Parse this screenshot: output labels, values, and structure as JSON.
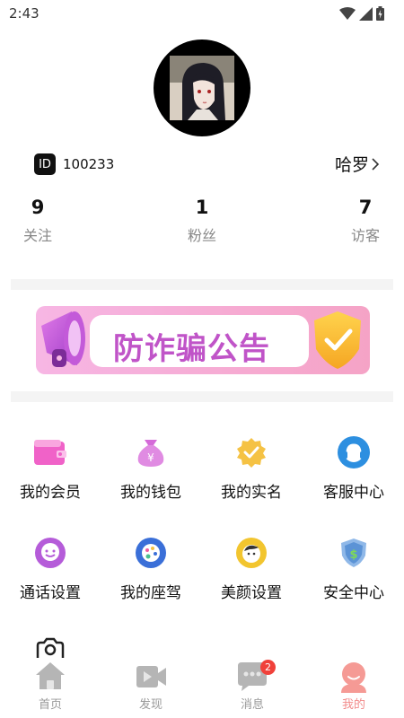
{
  "status_bar": {
    "time": "2:43",
    "icons": [
      "wifi-icon",
      "signal-icon",
      "battery-icon"
    ]
  },
  "profile": {
    "id_badge": "ID",
    "id_value": "100233",
    "name": "哈罗",
    "stats": [
      {
        "num": "9",
        "label": "关注"
      },
      {
        "num": "1",
        "label": "粉丝"
      },
      {
        "num": "7",
        "label": "访客"
      }
    ]
  },
  "banner": {
    "text": "防诈骗公告"
  },
  "menu": {
    "items": [
      {
        "label": "我的会员",
        "icon": "member-card-icon"
      },
      {
        "label": "我的钱包",
        "icon": "wallet-bag-icon"
      },
      {
        "label": "我的实名",
        "icon": "verified-badge-icon"
      },
      {
        "label": "客服中心",
        "icon": "headset-icon"
      },
      {
        "label": "通话设置",
        "icon": "chat-smile-icon"
      },
      {
        "label": "我的座驾",
        "icon": "palette-icon"
      },
      {
        "label": "美颜设置",
        "icon": "beauty-icon"
      },
      {
        "label": "安全中心",
        "icon": "shield-icon"
      },
      {
        "label": "",
        "icon": "camera-icon"
      }
    ]
  },
  "tabbar": {
    "tabs": [
      {
        "label": "首页",
        "icon": "home-icon"
      },
      {
        "label": "发现",
        "icon": "video-icon"
      },
      {
        "label": "消息",
        "icon": "message-icon",
        "badge": "2"
      },
      {
        "label": "我的",
        "icon": "profile-icon"
      }
    ],
    "active_color": "#f28b8b",
    "inactive_color": "#999999"
  }
}
